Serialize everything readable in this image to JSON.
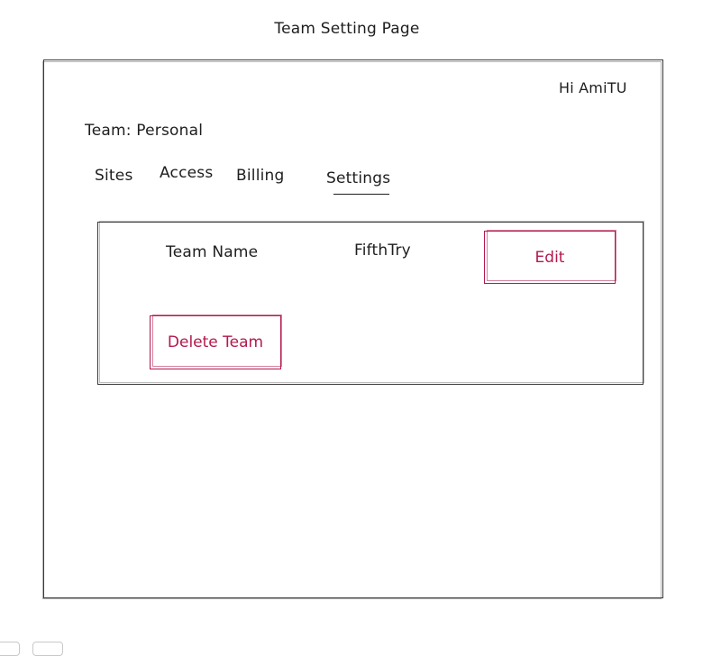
{
  "page": {
    "title": "Team Setting Page"
  },
  "header": {
    "greeting": "Hi AmiTU"
  },
  "team": {
    "label": "Team: Personal"
  },
  "tabs": [
    {
      "label": "Sites"
    },
    {
      "label": "Access"
    },
    {
      "label": "Billing"
    },
    {
      "label": "Settings"
    }
  ],
  "active_tab": "Settings",
  "settings": {
    "field_label": "Team Name",
    "field_value": "FifthTry",
    "edit_label": "Edit",
    "delete_label": "Delete Team"
  },
  "colors": {
    "accent": "#b3194d",
    "stroke": "#1e1e1e"
  }
}
